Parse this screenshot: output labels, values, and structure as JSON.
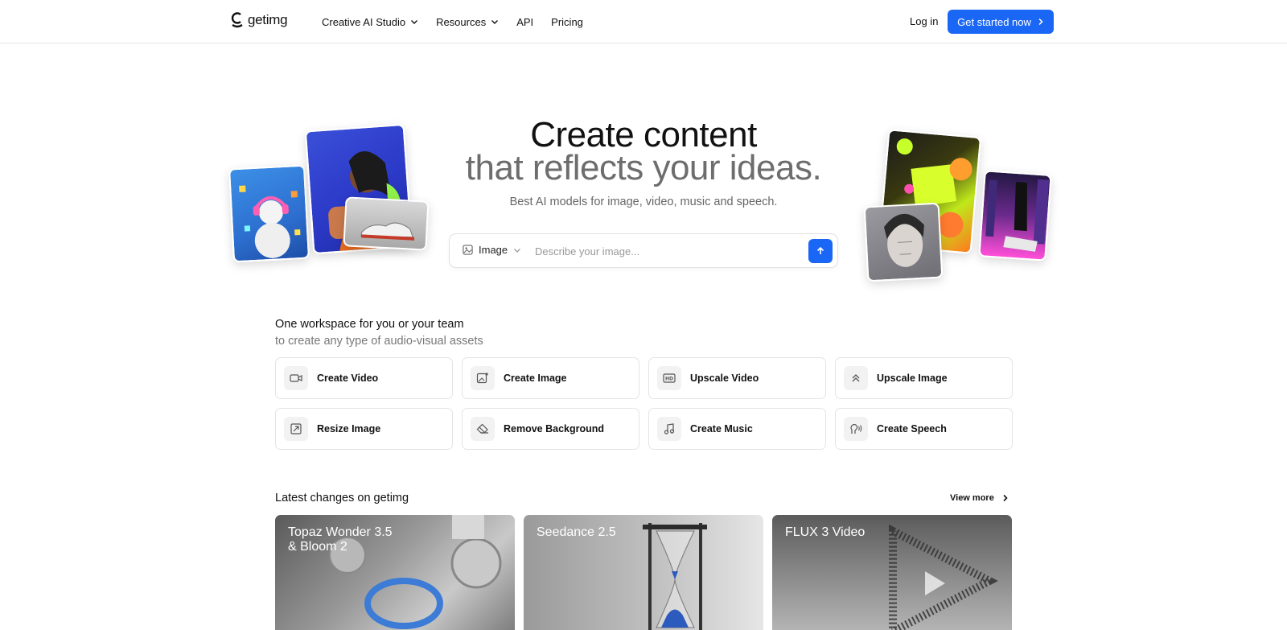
{
  "header": {
    "logo": "getimg",
    "nav": [
      {
        "label": "Creative AI Studio",
        "dropdown": true
      },
      {
        "label": "Resources",
        "dropdown": true
      },
      {
        "label": "API",
        "dropdown": false
      },
      {
        "label": "Pricing",
        "dropdown": false
      }
    ],
    "login": "Log in",
    "cta": "Get started now"
  },
  "hero": {
    "title": "Create content",
    "subtitle": "that reflects your ideas.",
    "description": "Best AI models for image, video, music and speech.",
    "prompt": {
      "type": "Image",
      "placeholder": "Describe your image..."
    }
  },
  "workspace": {
    "title": "One workspace for you or your team",
    "subtitle": "to create any type of audio-visual assets",
    "tools": [
      {
        "label": "Create Video",
        "icon": "video-camera-icon"
      },
      {
        "label": "Create Image",
        "icon": "image-plus-icon"
      },
      {
        "label": "Upscale Video",
        "icon": "hd-icon"
      },
      {
        "label": "Upscale Image",
        "icon": "double-chevron-up-icon"
      },
      {
        "label": "Resize Image",
        "icon": "resize-icon"
      },
      {
        "label": "Remove Background",
        "icon": "eraser-icon"
      },
      {
        "label": "Create Music",
        "icon": "music-note-icon"
      },
      {
        "label": "Create Speech",
        "icon": "speech-icon"
      }
    ]
  },
  "latest": {
    "title": "Latest changes on getimg",
    "view_more": "View more",
    "items": [
      {
        "title": "Topaz Wonder 3.5\n& Bloom 2"
      },
      {
        "title": "Seedance 2.5"
      },
      {
        "title": "FLUX 3 Video"
      }
    ]
  },
  "colors": {
    "accent": "#1a66f5",
    "text": "#111111",
    "muted": "#6d6d6d",
    "border": "#e4e4e4"
  }
}
